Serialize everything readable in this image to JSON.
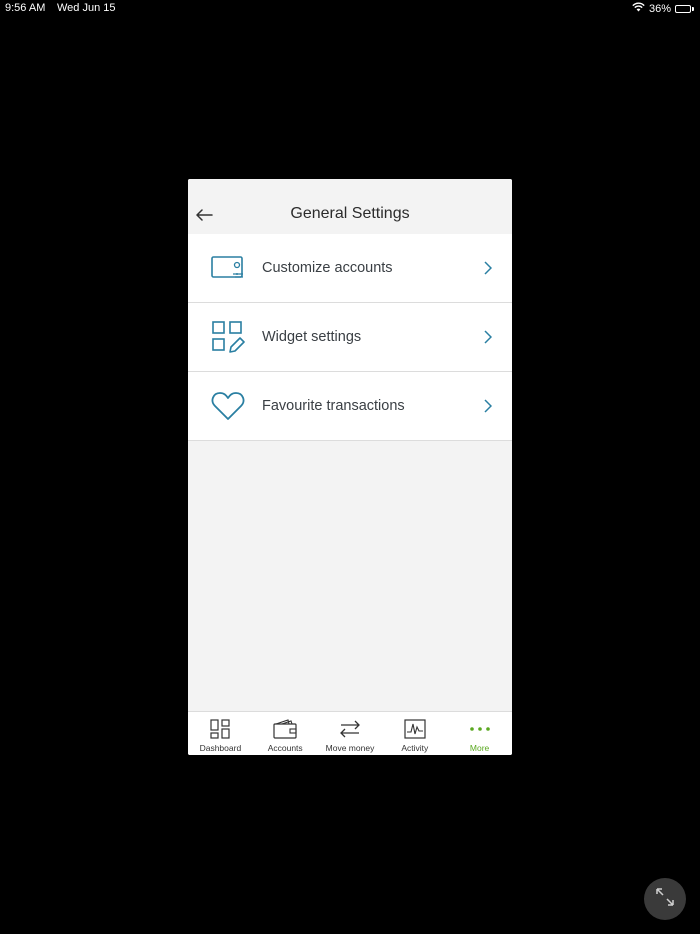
{
  "status_bar": {
    "time": "9:56 AM",
    "date": "Wed Jun 15",
    "battery_percent": "36%",
    "battery_level": 0.36,
    "wifi_icon": "wifi-icon",
    "battery_icon": "battery-charging-icon"
  },
  "header": {
    "title": "General Settings",
    "back_icon": "arrow-left-icon"
  },
  "settings_items": [
    {
      "label": "Customize accounts",
      "icon": "wallet-card-icon"
    },
    {
      "label": "Widget settings",
      "icon": "grid-edit-icon"
    },
    {
      "label": "Favourite transactions",
      "icon": "heart-icon"
    }
  ],
  "tab_bar": {
    "tabs": [
      {
        "label": "Dashboard",
        "icon": "dashboard-icon",
        "active": false
      },
      {
        "label": "Accounts",
        "icon": "wallet-icon",
        "active": false
      },
      {
        "label": "Move money",
        "icon": "transfer-arrows-icon",
        "active": false
      },
      {
        "label": "Activity",
        "icon": "activity-chart-icon",
        "active": false
      },
      {
        "label": "More",
        "icon": "more-dots-icon",
        "active": true
      }
    ]
  },
  "colors": {
    "accent": "#2a7fa2",
    "active_tab": "#5aa820",
    "background": "#000000",
    "panel": "#f3f3f3"
  }
}
